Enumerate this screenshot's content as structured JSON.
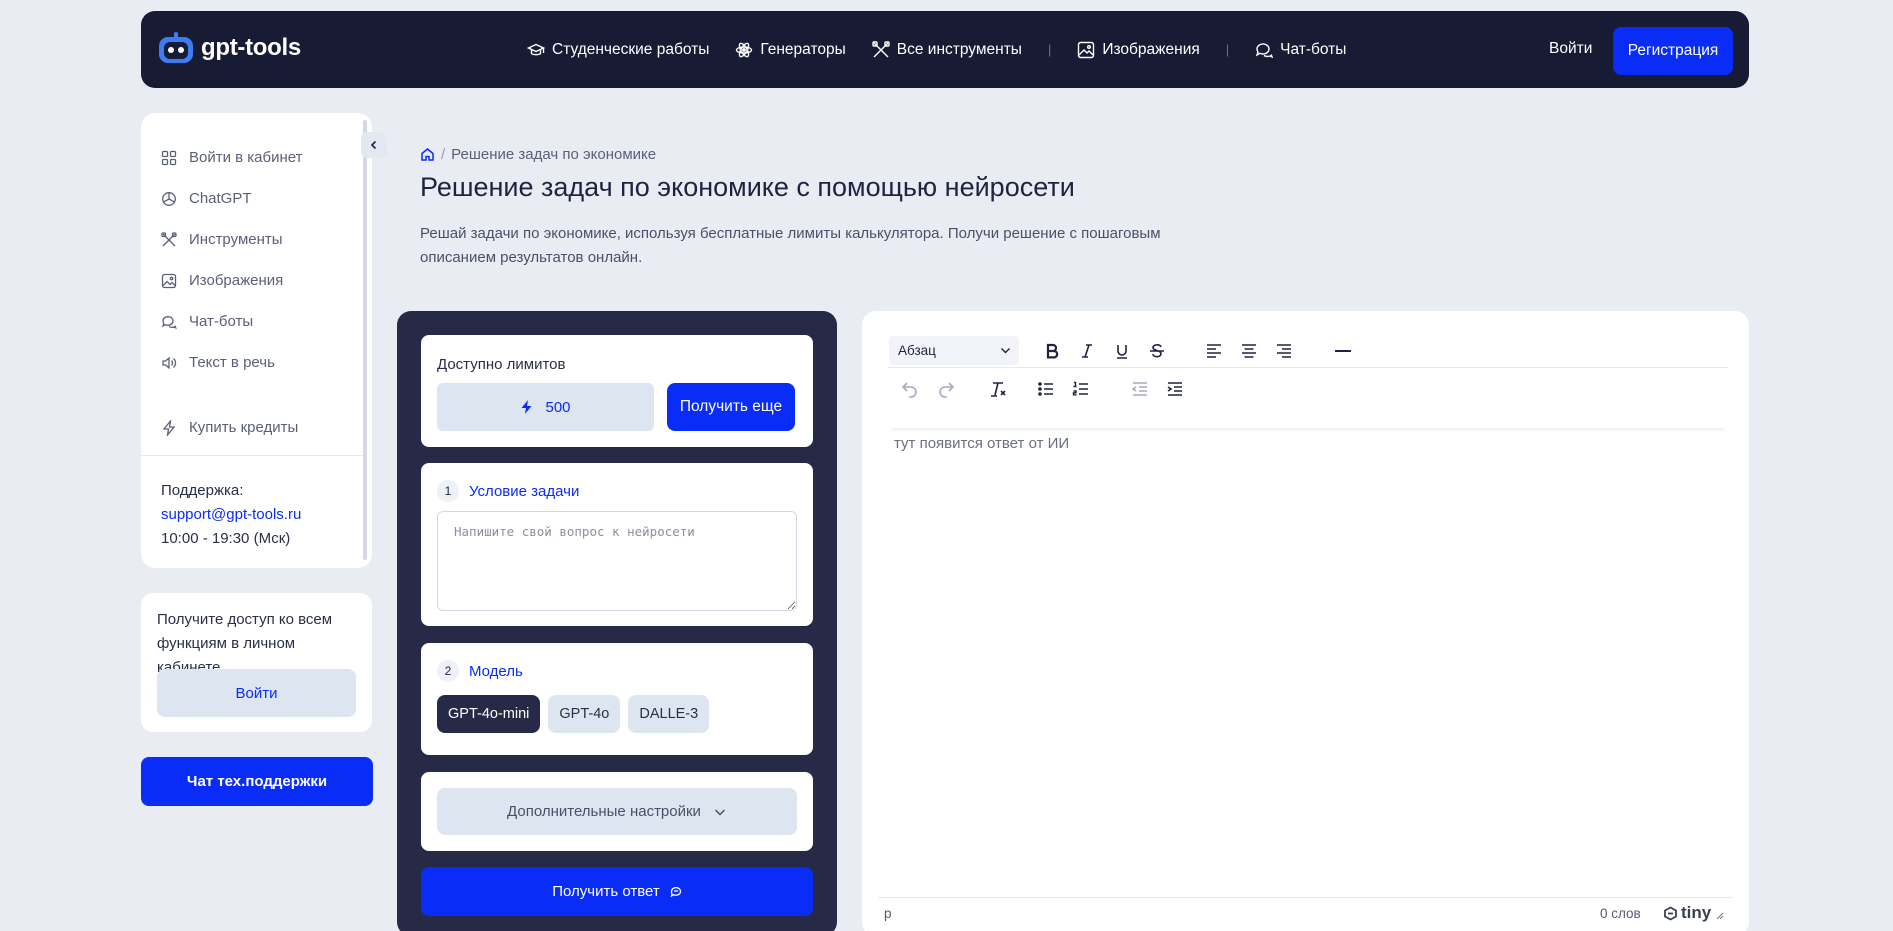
{
  "header": {
    "logo_text": "gpt-tools",
    "nav": [
      {
        "label": "Студенческие работы",
        "icon": "graduation-cap-icon"
      },
      {
        "label": "Генераторы",
        "icon": "atom-icon"
      },
      {
        "label": "Все инструменты",
        "icon": "tools-icon"
      },
      {
        "label": "Изображения",
        "icon": "image-icon"
      },
      {
        "label": "Чат-боты",
        "icon": "chat-icon"
      }
    ],
    "separator": "|",
    "login_label": "Войти",
    "register_label": "Регистрация"
  },
  "sidebar": {
    "items": [
      {
        "label": "Войти в кабинет",
        "icon": "grid-icon"
      },
      {
        "label": "ChatGPT",
        "icon": "openai-icon"
      },
      {
        "label": "Инструменты",
        "icon": "tools-icon"
      },
      {
        "label": "Изображения",
        "icon": "image-icon"
      },
      {
        "label": "Чат-боты",
        "icon": "chat-icon"
      },
      {
        "label": "Текст в речь",
        "icon": "speaker-icon"
      },
      {
        "label": "Купить кредиты",
        "icon": "lightning-icon"
      }
    ],
    "support_label": "Поддержка:",
    "support_email": "support@gpt-tools.ru",
    "support_hours": "10:00 - 19:30 (Мск)",
    "access_text": "Получите доступ ко всем функциям в личном кабинете",
    "access_button": "Войти",
    "support_chat_button": "Чат тех.поддержки"
  },
  "main": {
    "breadcrumb": "Решение задач по экономике",
    "title": "Решение задач по экономике с помощью нейросети",
    "description": "Решай задачи по экономике, используя бесплатные лимиты калькулятора. Получи решение с пошаговым описанием результатов онлайн."
  },
  "form": {
    "limits_title": "Доступно лимитов",
    "limits_count": "500",
    "get_more_button": "Получить еще",
    "step1_num": "1",
    "step1_title": "Условие задачи",
    "task_placeholder": "Напишите свой вопрос к нейросети",
    "step2_num": "2",
    "step2_title": "Модель",
    "models": [
      {
        "label": "GPT-4o-mini",
        "active": true
      },
      {
        "label": "GPT-4o",
        "active": false
      },
      {
        "label": "DALLE-3",
        "active": false
      }
    ],
    "settings_button": "Дополнительные настройки",
    "submit_button": "Получить ответ"
  },
  "editor": {
    "format_select": "Абзац",
    "placeholder": "тут появится ответ от ИИ",
    "status_path": "p",
    "word_count": "0 слов",
    "brand": "tiny"
  },
  "colors": {
    "accent": "#0a2cf7",
    "header_bg": "#171b33",
    "panel_bg": "#262a47",
    "page_bg": "#e9ecf3",
    "soft_button": "#dde6f0"
  }
}
